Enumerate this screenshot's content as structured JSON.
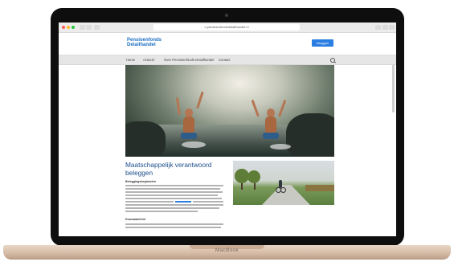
{
  "browser": {
    "url": "c.pensioenfondsdetailhandel.nl"
  },
  "site": {
    "logo_line1": "Pensioenfonds",
    "logo_line2": "Detailhandel",
    "cta_label": "Inloggen",
    "nav": [
      "Home",
      "Actueel",
      "Over Pensioenfonds Detailhandel",
      "Contact"
    ]
  },
  "article": {
    "title": "Maatschappelijk verantwoord beleggen",
    "subheading": "Beleggingsbeginselen",
    "subheading2": "Duurzaamheid"
  },
  "device": {
    "brand_label": "MacBook"
  },
  "colors": {
    "accent": "#2a7de1",
    "title": "#1d4f8c"
  }
}
